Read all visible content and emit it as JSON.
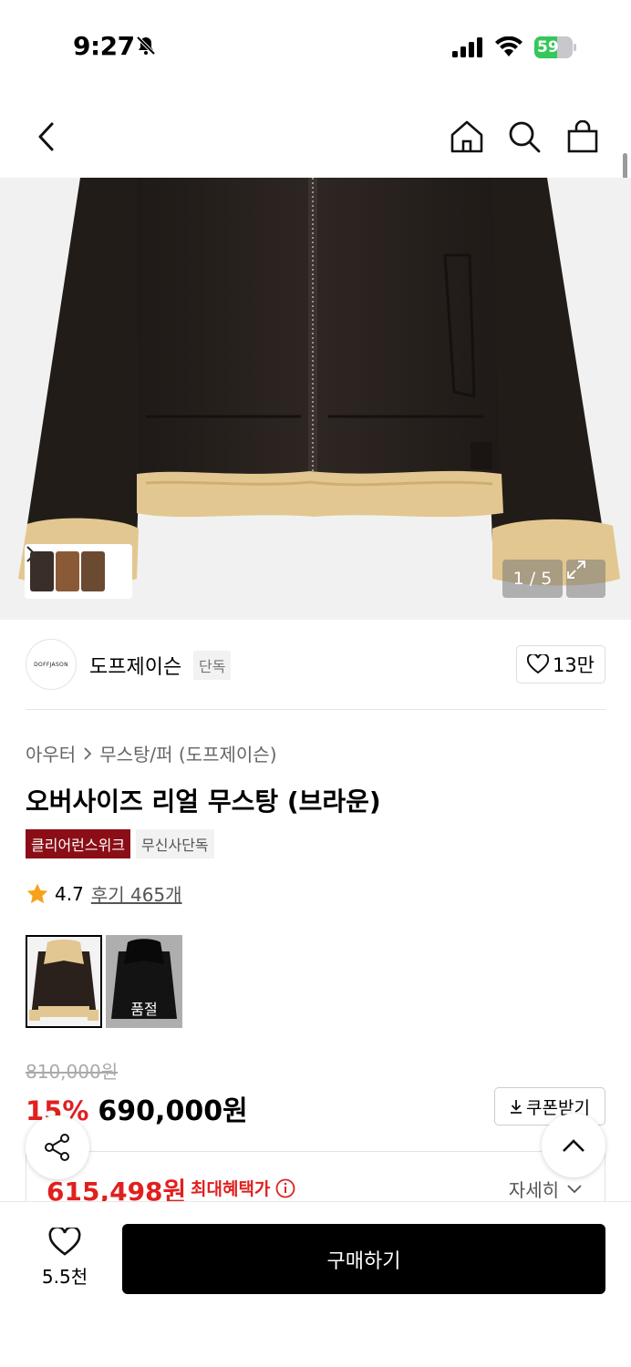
{
  "status_bar": {
    "time": "9:27",
    "battery": "59",
    "battery_level": 0.59,
    "icons": [
      "bell-slash-icon",
      "cellular-signal-icon",
      "wifi-icon",
      "battery-charging-icon"
    ]
  },
  "nav": {
    "icons": [
      "back-chevron-icon",
      "home-icon",
      "search-icon",
      "shopping-bag-icon"
    ]
  },
  "gallery": {
    "counter": "1 / 5",
    "current": 1,
    "total": 5
  },
  "brand": {
    "logo_text": "DOFFJASON",
    "name": "도프제이슨",
    "badge": "단독",
    "likes": "13만"
  },
  "breadcrumb": {
    "category": "아우터",
    "subcategory": "무스탕/퍼 (도프제이슨)"
  },
  "product": {
    "title": "오버사이즈 리얼 무스탕 (브라운)",
    "badges": [
      "클리어런스위크",
      "무신사단독"
    ],
    "rating": "4.7",
    "reviews": "후기 465개"
  },
  "color_options": [
    {
      "name": "brown",
      "selected": true,
      "sold_out": false
    },
    {
      "name": "black",
      "selected": false,
      "sold_out": true,
      "label": "품절"
    }
  ],
  "pricing": {
    "original": "810,000원",
    "discount": "15%",
    "price": "690,000원",
    "coupon_label": "쿠폰받기",
    "benefit_price": "615,498원",
    "benefit_label": "최대혜택가",
    "detail_label": "자세히"
  },
  "bottom_bar": {
    "wish_count": "5.5천",
    "buy_label": "구매하기"
  },
  "colors": {
    "sale_red": "#e0201f",
    "badge_red": "#8b0e17",
    "battery_green": "#34c759"
  }
}
